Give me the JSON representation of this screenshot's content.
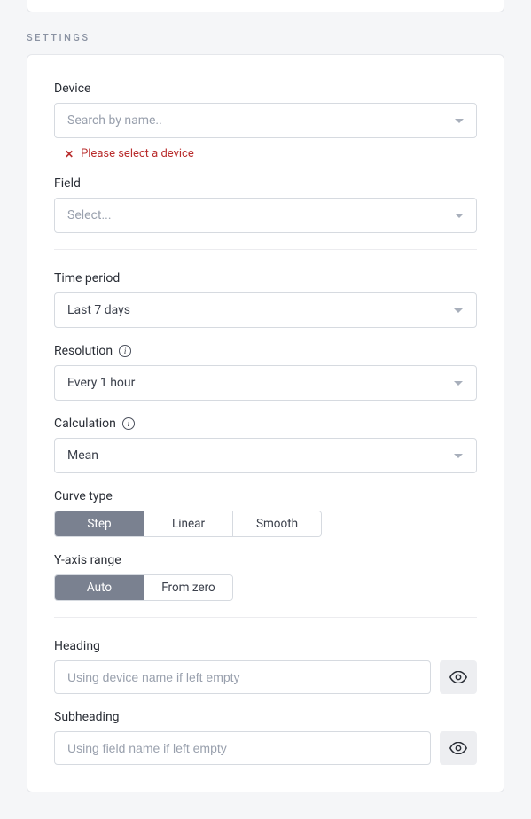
{
  "section_label": "SETTINGS",
  "device": {
    "label": "Device",
    "placeholder": "Search by name..",
    "error": "Please select a device"
  },
  "field": {
    "label": "Field",
    "placeholder": "Select..."
  },
  "time_period": {
    "label": "Time period",
    "value": "Last 7 days"
  },
  "resolution": {
    "label": "Resolution",
    "value": "Every 1 hour"
  },
  "calculation": {
    "label": "Calculation",
    "value": "Mean"
  },
  "curve_type": {
    "label": "Curve type",
    "options": [
      "Step",
      "Linear",
      "Smooth"
    ],
    "active": "Step"
  },
  "y_axis": {
    "label": "Y-axis range",
    "options": [
      "Auto",
      "From zero"
    ],
    "active": "Auto"
  },
  "heading": {
    "label": "Heading",
    "placeholder": "Using device name if left empty",
    "value": ""
  },
  "subheading": {
    "label": "Subheading",
    "placeholder": "Using field name if left empty",
    "value": ""
  }
}
